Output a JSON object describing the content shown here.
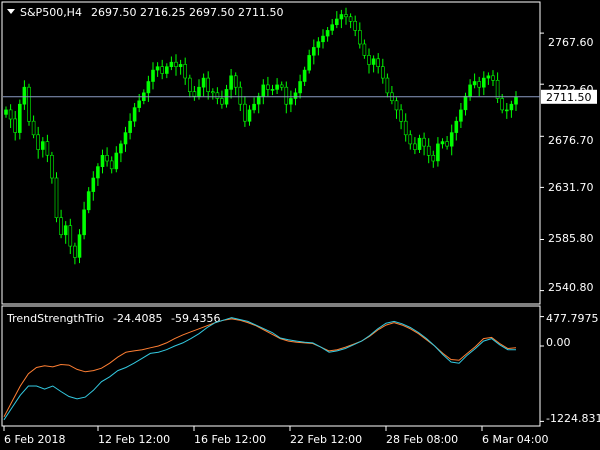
{
  "main_panel": {
    "symbol_header": "S&P500,H4",
    "ohlc": "2697.50 2716.25 2697.50 2711.50",
    "price_scale": [
      "2767.60",
      "2722.60",
      "2676.70",
      "2631.70",
      "2585.80",
      "2540.80"
    ],
    "current_price": "2711.50",
    "current_price_value": 2711.5
  },
  "indicator_panel": {
    "name": "TrendStrengthTrio",
    "value_1": "-24.4085",
    "value_2": "-59.4356",
    "scale": [
      "477.7975",
      "0.00",
      "-1224.8317"
    ]
  },
  "time_axis": {
    "labels": [
      "6 Feb 2018",
      "12 Feb 12:00",
      "16 Feb 12:00",
      "22 Feb 12:00",
      "28 Feb 08:00",
      "6 Mar 04:00"
    ]
  },
  "chart_data": {
    "type": "candlestick",
    "price_ylim": [
      2529,
      2795
    ],
    "price_ticks": [
      2767.6,
      2722.6,
      2676.7,
      2631.7,
      2585.8,
      2540.8
    ],
    "closes": [
      2700,
      2692,
      2680,
      2705,
      2720,
      2690,
      2678,
      2665,
      2672,
      2660,
      2640,
      2605,
      2590,
      2598,
      2580,
      2570,
      2590,
      2612,
      2628,
      2640,
      2650,
      2660,
      2655,
      2648,
      2662,
      2670,
      2680,
      2690,
      2702,
      2708,
      2715,
      2725,
      2735,
      2738,
      2732,
      2738,
      2742,
      2738,
      2740,
      2728,
      2716,
      2712,
      2720,
      2728,
      2716,
      2715,
      2710,
      2705,
      2718,
      2730,
      2720,
      2705,
      2690,
      2700,
      2705,
      2712,
      2722,
      2718,
      2718,
      2722,
      2720,
      2705,
      2710,
      2715,
      2725,
      2735,
      2748,
      2755,
      2760,
      2765,
      2770,
      2775,
      2780,
      2784,
      2782,
      2778,
      2770,
      2758,
      2748,
      2740,
      2745,
      2738,
      2728,
      2715,
      2708,
      2700,
      2690,
      2678,
      2670,
      2665,
      2675,
      2668,
      2660,
      2655,
      2670,
      2672,
      2668,
      2680,
      2690,
      2700,
      2712,
      2722,
      2725,
      2720,
      2728,
      2730,
      2726,
      2710,
      2700,
      2700,
      2705,
      2711.5
    ],
    "indicator_ylim": [
      -1300,
      650
    ],
    "indicator_ticks": [
      477.7975,
      0,
      -1224.8317
    ],
    "series": [
      {
        "name": "",
        "color": "#ff7f33",
        "values": [
          -1150,
          -900,
          -650,
          -450,
          -350,
          -320,
          -340,
          -300,
          -310,
          -380,
          -420,
          -400,
          -360,
          -280,
          -180,
          -100,
          -80,
          -60,
          -30,
          0,
          50,
          120,
          180,
          230,
          280,
          330,
          380,
          420,
          440,
          420,
          380,
          330,
          260,
          190,
          120,
          80,
          60,
          50,
          40,
          -20,
          -80,
          -60,
          -20,
          30,
          80,
          160,
          260,
          340,
          380,
          340,
          280,
          200,
          100,
          0,
          -120,
          -220,
          -230,
          -120,
          -10,
          120,
          140,
          40,
          -40,
          -28
        ],
        "color_name": "orange"
      },
      {
        "name": "",
        "color": "#33c9e0",
        "values": [
          -1200,
          -1000,
          -800,
          -650,
          -650,
          -700,
          -650,
          -740,
          -820,
          -860,
          -830,
          -720,
          -580,
          -500,
          -400,
          -350,
          -280,
          -200,
          -120,
          -100,
          -60,
          0,
          50,
          120,
          200,
          300,
          380,
          420,
          460,
          430,
          400,
          340,
          280,
          220,
          130,
          100,
          80,
          60,
          50,
          -20,
          -100,
          -80,
          -40,
          20,
          80,
          170,
          280,
          370,
          400,
          360,
          300,
          220,
          120,
          0,
          -140,
          -260,
          -280,
          -150,
          -40,
          80,
          120,
          20,
          -60,
          -60
        ],
        "color_name": "cyan"
      }
    ]
  },
  "colors": {
    "background": "#000000",
    "candle_bull": "#00ff00",
    "grid_border": "#ffffff",
    "current_price_line": "#8c9cc4",
    "price_tag_bg": "#ffffff",
    "price_tag_text": "#000000",
    "line_orange": "#ff7f33",
    "line_cyan": "#33c9e0"
  }
}
